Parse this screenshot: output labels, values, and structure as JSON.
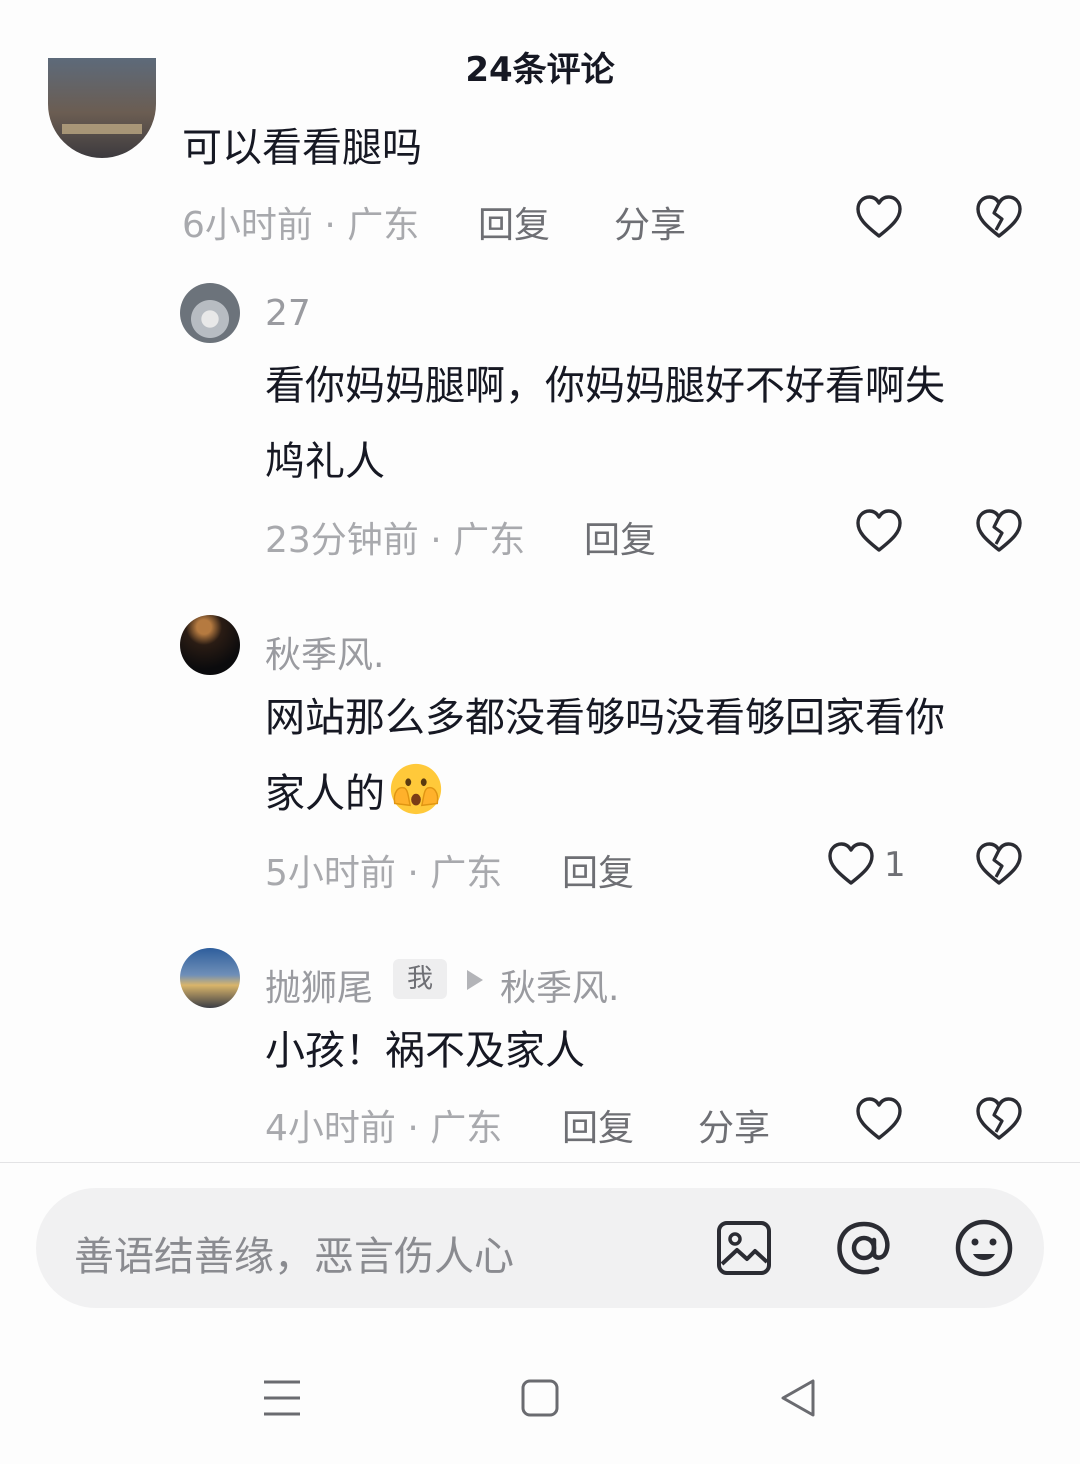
{
  "header": {
    "title": "24条评论"
  },
  "comments": [
    {
      "text": "可以看看腿吗",
      "meta": "6小时前 · 广东",
      "reply_label": "回复",
      "share_label": "分享"
    },
    {
      "name": "27",
      "text_lines": [
        "看你妈妈腿啊，你妈妈腿好不好看啊失",
        "鸠礼人"
      ],
      "meta": "23分钟前 · 广东",
      "reply_label": "回复"
    },
    {
      "name": "秋季风.",
      "text_lines": [
        "网站那么多都没看够吗没看够回家看你",
        "家人的"
      ],
      "emoji": "face-with-hands-over-mouth",
      "meta": "5小时前 · 广东",
      "reply_label": "回复",
      "like_count": "1"
    },
    {
      "name": "抛狮尾",
      "badge": "我",
      "reply_to": "秋季风.",
      "text": "小孩！祸不及家人",
      "meta": "4小时前 · 广东",
      "reply_label": "回复",
      "share_label": "分享"
    }
  ],
  "input": {
    "placeholder": "善语结善缘，恶言伤人心"
  },
  "icons": {
    "like": "heart-outline-icon",
    "dislike": "broken-heart-icon",
    "image": "image-icon",
    "mention": "at-icon",
    "emoji": "emoji-face-icon",
    "nav_menu": "menu-icon",
    "nav_home": "home-square-icon",
    "nav_back": "back-triangle-icon"
  },
  "colors": {
    "text_primary": "#161823",
    "text_secondary": "#a8a9ad",
    "action": "#6e6f74",
    "input_bg": "#f1f1f2"
  }
}
